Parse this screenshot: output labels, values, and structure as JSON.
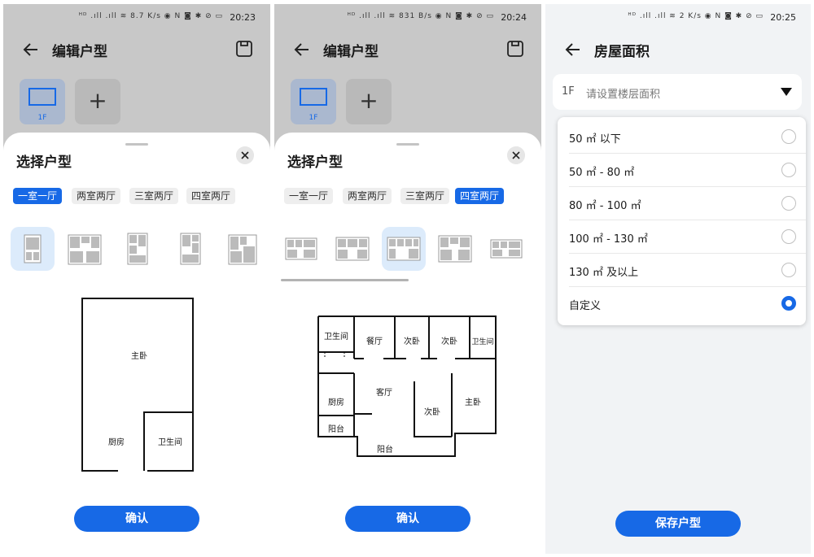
{
  "statusbar": {
    "screen1": {
      "icons_text": "ᴴᴰ .ıll .ıll ≋ 8.7 K/s  ◉ N ◙ ✱ ⊘ ▭",
      "time": "20:23"
    },
    "screen2": {
      "icons_text": "ᴴᴰ .ıll .ıll ≋ 831 B/s  ◉ N ◙ ✱ ⊘ ▭",
      "time": "20:24"
    },
    "screen3": {
      "icons_text": "ᴴᴰ .ıll .ıll ≋ 2 K/s  ◉ N ◙ ✱ ⊘ ▭",
      "time": "20:25"
    }
  },
  "edit_screen": {
    "title": "编辑户型",
    "floor_label": "1F",
    "add_symbol": "+",
    "sheet_title": "选择户型",
    "close_symbol": "✕",
    "chips": [
      "一室一厅",
      "两室两厅",
      "三室两厅",
      "四室两厅"
    ],
    "confirm_label": "确认"
  },
  "screen1": {
    "active_chip": 0,
    "rooms": {
      "master": "主卧",
      "kitchen": "厨房",
      "bathroom": "卫生间"
    }
  },
  "screen2": {
    "active_chip": 3,
    "rooms": {
      "bath_left": "卫生间",
      "dining": "餐厅",
      "bed2": "次卧",
      "bed3": "次卧",
      "bath_right": "卫生间",
      "living": "客厅",
      "kitchen": "厨房",
      "bed4": "次卧",
      "master": "主卧",
      "balcony_left": "阳台",
      "balcony_bottom": "阳台"
    }
  },
  "area_screen": {
    "title": "房屋面积",
    "floor_code": "1F",
    "placeholder": "请设置楼层面积",
    "options": [
      {
        "label": "50 ㎡ 以下",
        "selected": false
      },
      {
        "label": "50 ㎡ - 80 ㎡",
        "selected": false
      },
      {
        "label": "80 ㎡ - 100 ㎡",
        "selected": false
      },
      {
        "label": "100 ㎡ - 130 ㎡",
        "selected": false
      },
      {
        "label": "130 ㎡ 及以上",
        "selected": false
      },
      {
        "label": "自定义",
        "selected": true
      }
    ],
    "save_label": "保存户型"
  },
  "colors": {
    "accent": "#1769e6",
    "dim_background": "#c8c8c8",
    "page_background": "#f1f3f5"
  },
  "icons": [
    "back-arrow-icon",
    "save-icon",
    "plus-icon",
    "close-icon",
    "dropdown-triangle-icon",
    "radio-icon"
  ]
}
